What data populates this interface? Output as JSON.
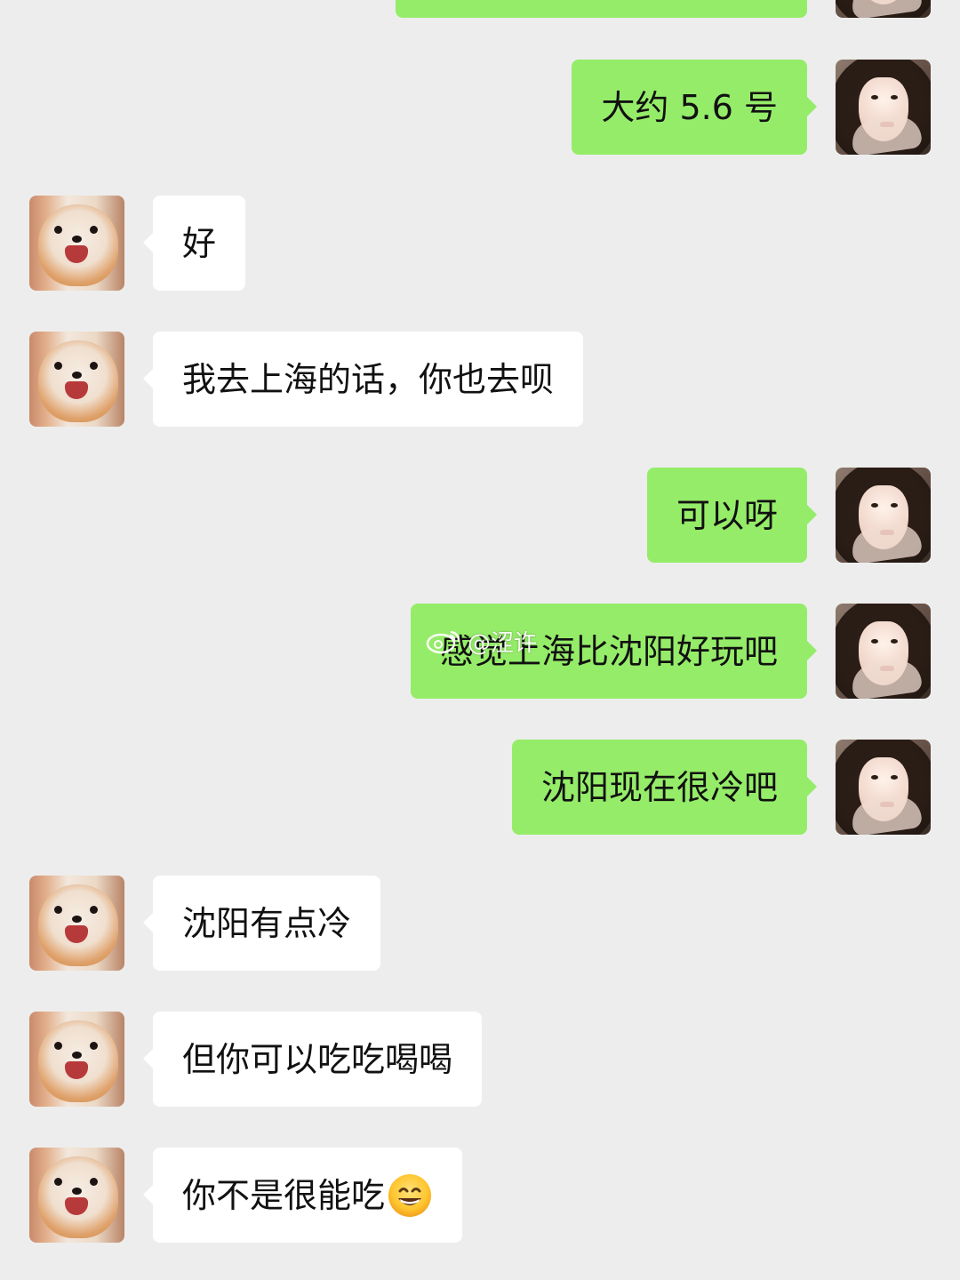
{
  "messages": [
    {
      "side": "right",
      "sender": "girl",
      "text": ""
    },
    {
      "side": "right",
      "sender": "girl",
      "text": "大约 5.6 号"
    },
    {
      "side": "left",
      "sender": "dog",
      "text": "好"
    },
    {
      "side": "left",
      "sender": "dog",
      "text": "我去上海的话，你也去呗"
    },
    {
      "side": "right",
      "sender": "girl",
      "text": "可以呀"
    },
    {
      "side": "right",
      "sender": "girl",
      "text": "感觉上海比沈阳好玩吧"
    },
    {
      "side": "right",
      "sender": "girl",
      "text": "沈阳现在很冷吧"
    },
    {
      "side": "left",
      "sender": "dog",
      "text": "沈阳有点冷"
    },
    {
      "side": "left",
      "sender": "dog",
      "text": "但你可以吃吃喝喝"
    },
    {
      "side": "left",
      "sender": "dog",
      "text": "你不是很能吃",
      "emoji": "grinning-face-emoji"
    }
  ],
  "watermark": {
    "text": "@涩许",
    "icon": "weibo-logo-icon"
  },
  "colors": {
    "background": "#ededed",
    "bubble_sent": "#95ec69",
    "bubble_received": "#ffffff",
    "text": "#111111"
  }
}
